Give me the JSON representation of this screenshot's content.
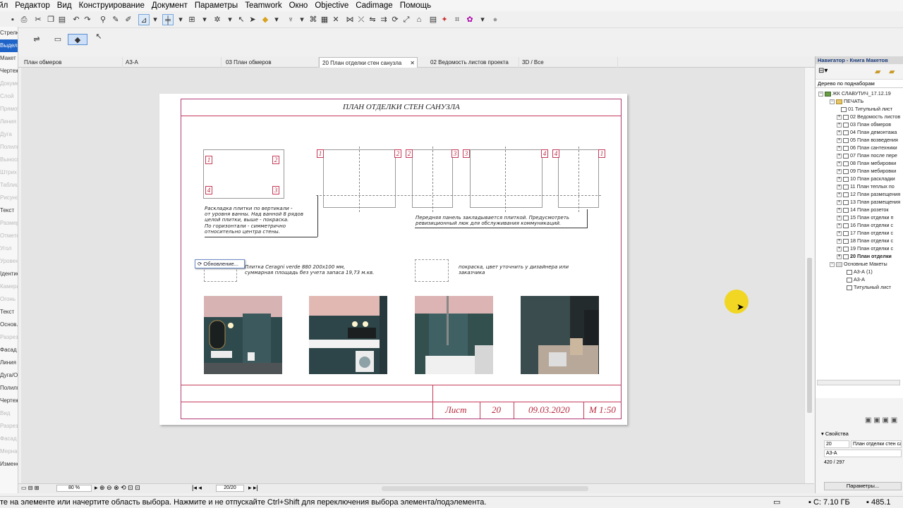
{
  "menu": [
    "Файл",
    "Редактор",
    "Вид",
    "Конструирование",
    "Документ",
    "Параметры",
    "Teamwork",
    "Окно",
    "Objective",
    "Cadimage",
    "Помощь"
  ],
  "left_panel": {
    "items": [
      "Стрелка",
      "Выделить...",
      "",
      "Макет",
      "Чертеж",
      "Документ",
      "Слой",
      "Прямоуг",
      "Линия",
      "Дуга",
      "Полилиния",
      "Текст",
      "Выноска",
      "Штрих",
      "Таблица",
      "Рисунок",
      "Размер",
      "Отметка",
      "Угол",
      "Уровень",
      "Изменение...",
      "Ідентиф",
      "Камера",
      "Огонь",
      "Объект",
      "Текст",
      "Основ.",
      "Разрез",
      "Фасад",
      "Линия",
      "Дуга/О...",
      "Полили...",
      "Чертеж",
      "Вид",
      "Разрез",
      "Фасад",
      "Мерная",
      "Деталь",
      "Изменение..."
    ]
  },
  "tabs": [
    {
      "label": "План обмеров",
      "active": false
    },
    {
      "label": "А3-А",
      "active": false
    },
    {
      "label": "03 План обмеров",
      "active": false
    },
    {
      "label": "20 План отделки стен санузла",
      "active": true
    },
    {
      "label": "02 Ведомость листов проекта",
      "active": false
    },
    {
      "label": "3D / Все",
      "active": false
    }
  ],
  "sheet": {
    "title": "ПЛАН ОТДЕЛКИ СТЕН САНУЗЛА",
    "wall_markers": {
      "tl": "1",
      "tr": "2",
      "bl": "4",
      "br": "3"
    },
    "elev_markers": [
      "1",
      "2",
      "2",
      "3",
      "3",
      "4",
      "4",
      "1"
    ],
    "note_left": [
      "Раскладка плитки по вертикали -",
      "от уровня ванны. Над ванной 8 рядов",
      "целой плитки, выше - покраска.",
      "По горизонтали - симметрично",
      "относительно центра стены."
    ],
    "note_right": [
      "Передняя панель закладывается плиткой. Предусмотреть",
      "ревизиционный люк для обслуживания коммуникаций."
    ],
    "legend_tile": [
      "Плитка Ceragni verde 880 200х100 мм,",
      "суммарная площадь без учета запаса 19,73 м.кв."
    ],
    "legend_paint": [
      "покраска, цвет уточнить у дизайнера или",
      "заказчика"
    ],
    "updating_label": "Обновление...",
    "stamp": {
      "sheet_label": "Лист",
      "sheet_number": "20",
      "date": "09.03.2020",
      "scale": "М 1:50"
    }
  },
  "navigator": {
    "title": "Навигатор - Книга Макетов",
    "view_mode": "Дерево по поднаборам",
    "project": "ЖК СЛАВУТИЧ_17.12.19",
    "folder": "ПЕЧАТЬ",
    "sheets": [
      "01 Титульный лист",
      "02 Ведомость листов",
      "03 План обмеров",
      "04 План демонтажа",
      "05 План возведения",
      "06 План сантехники",
      "07 План после пере",
      "08 План мебировки",
      "09 План мебировки",
      "10 План раскладки",
      "11 План теплых по",
      "12 План размещения",
      "13 План размещения",
      "14 План розеток",
      "15 План отделки п",
      "16 План отделки с",
      "17 План отделки с",
      "18 План отделки с",
      "19 План отделки с",
      "20 План отделки"
    ],
    "masters_folder": "Основные Макеты",
    "masters": [
      "А3-А (1)",
      "А3-А",
      "Титульный лист"
    ],
    "props_header": "Свойства",
    "prop_id": "20",
    "prop_name": "План отделки стен са",
    "prop_master": "А3-А",
    "prop_size": "420 / 297",
    "params_button": "Параметры..."
  },
  "bottom": {
    "zoom": "80 %",
    "page": "20/20"
  },
  "status": {
    "message": "те на элементе или начертите область выбора. Нажмите и не отпускайте Ctrl+Shift для переключения выбора элемента/подэлемента.",
    "disk": "С: 7.10 ГБ",
    "mem": "485.1"
  },
  "colors": {
    "accent": "#b8283e",
    "frame": "#b03a76",
    "highlight": "#f2d40e"
  }
}
